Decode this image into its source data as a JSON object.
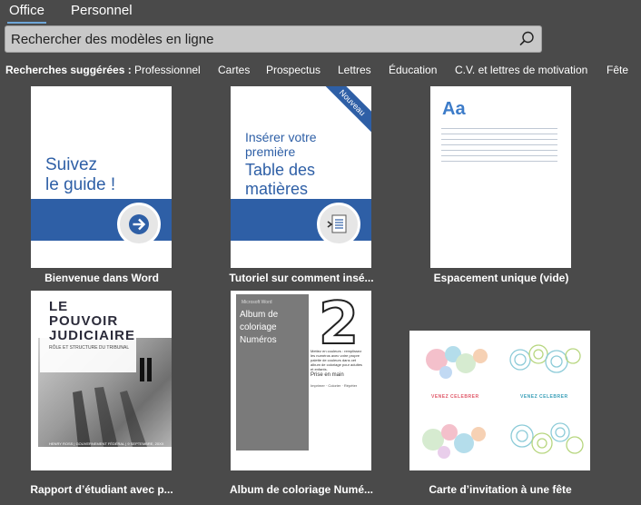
{
  "tabs": [
    {
      "label": "Office",
      "active": true
    },
    {
      "label": "Personnel",
      "active": false
    }
  ],
  "search": {
    "placeholder": "Rechercher des modèles en ligne",
    "value": ""
  },
  "suggested": {
    "label": "Recherches suggérées :",
    "items": [
      "Professionnel",
      "Cartes",
      "Prospectus",
      "Lettres",
      "Éducation",
      "C.V. et lettres de motivation",
      "Fête"
    ]
  },
  "templates": [
    {
      "caption": "Bienvenue dans Word",
      "thumb_line1": "Suivez",
      "thumb_line2": "le guide !"
    },
    {
      "caption": "Tutoriel sur comment insé...",
      "thumb_line1": "Insérer votre",
      "thumb_line2": "première",
      "thumb_line3": "Table des",
      "thumb_line4": "matières",
      "badge": "Nouveau"
    },
    {
      "caption": "Espacement unique (vide)",
      "thumb_text": "Aa"
    },
    {
      "caption": "Rapport d’étudiant avec p...",
      "thumb_title1": "LE",
      "thumb_title2": "POUVOIR",
      "thumb_title3": "JUDICIAIRE",
      "thumb_sub": "RÔLE ET STRUCTURE DU TRIBUNAL",
      "thumb_foot": "HENRY ROSS | GOUVERNEMENT FÉDÉRAL | 9 SEPTEMBRE, 20XX"
    },
    {
      "caption": "Album de coloriage Numé...",
      "thumb_small": "Microsoft Word",
      "thumb_title1": "Album de",
      "thumb_title2": "coloriage",
      "thumb_title3": "Numéros",
      "thumb_text": "Mettez en couleurs : remplissez les numéros avec votre propre palette de couleurs dans cet album de coloriage pour adultes et enfants.",
      "thumb_prise": "Prise en main",
      "thumb_tiny": "Imprimer · Colorier · Répéter",
      "thumb_number": "2"
    },
    {
      "caption": "Carte d’invitation à une fête",
      "thumb_venez1": "VENEZ CELEBRER",
      "thumb_venez2": "VENEZ CELEBRER"
    }
  ],
  "colors": {
    "background": "#4a4a4a",
    "accent_blue": "#2e5fa6",
    "tab_underline": "#6ea6d8"
  }
}
